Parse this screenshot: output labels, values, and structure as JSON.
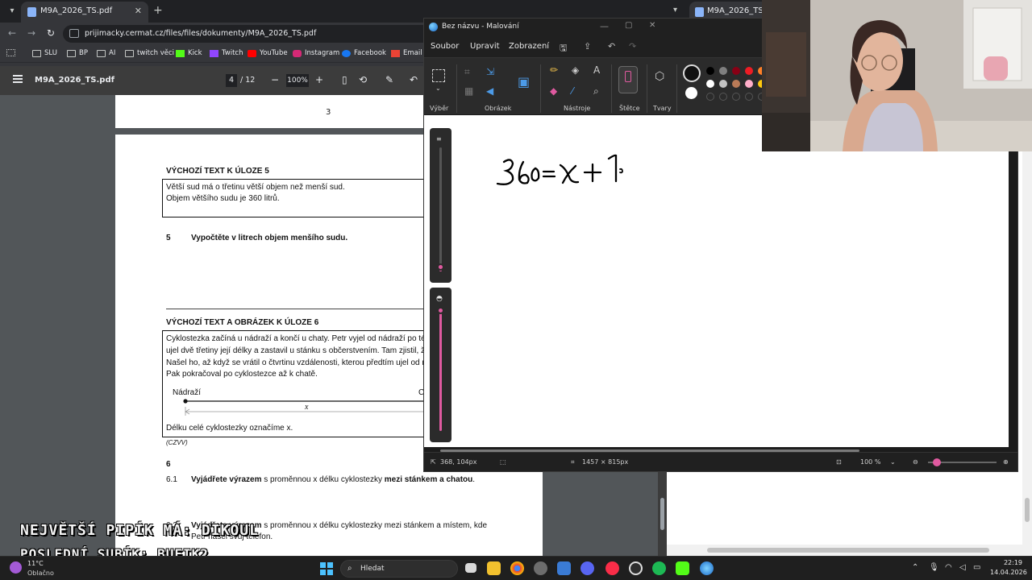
{
  "browser": {
    "tab_title": "M9A_2026_TS.pdf",
    "url": "prijimacky.cermat.cz/files/files/dokumenty/M9A_2026_TS.pdf",
    "bookmarks": [
      "SLU",
      "BP",
      "AI",
      "twitch věci",
      "Kick",
      "Twitch",
      "YouTube",
      "Instagram",
      "Facebook",
      "Email"
    ]
  },
  "pdf": {
    "filename": "M9A_2026_TS.pdf",
    "page_current": "4",
    "page_total": "/ 12",
    "zoom": "100%",
    "prev_page_number": "3",
    "section5_heading": "VÝCHOZÍ TEXT K ÚLOZE 5",
    "section5_line1": "Větší sud má o třetinu větší objem než menší sud.",
    "section5_line2": "Objem většího sudu je 360 litrů.",
    "task5_number": "5",
    "task5_text": "Vypočtěte v litrech objem menšího sudu.",
    "section6_heading": "VÝCHOZÍ TEXT A OBRÁZEK K ÚLOZE 6",
    "section6_line1": "Cyklostezka začíná u nádraží a končí u chaty. Petr vyjel od nádraží po tét",
    "section6_line2": "ujel dvě třetiny její délky a zastavil u stánku s občerstvením. Tam zjistil, ž",
    "section6_line3": "Našel ho, až když se vrátil o čtvrtinu vzdálenosti, kterou předtím ujel od n",
    "section6_line4": "Pak pokračoval po cyklostezce až k chatě.",
    "diagram_left_label": "Nádraží",
    "diagram_right_label": "C",
    "diagram_x_label": "x",
    "section6_caption": "Délku celé cyklostezky označíme x.",
    "source": "(CZVV)",
    "task6_number": "6",
    "task61_number": "6.1",
    "task61_bold": "Vyjádřete výrazem",
    "task61_rest": "s proměnnou x délku cyklostezky",
    "task61_bold2": "mezi stánkem a chatou",
    "task61_end": ".",
    "task62_number": "6.2",
    "task62_bold": "Vyjádřete výrazem",
    "task62_rest": "s proměnnou x délku cyklostezky mezi stánkem a místem, kde",
    "task62_line2": "Petr našel svůj telefon."
  },
  "right_browser": {
    "tab_title": "M9A_2026_TS.pdf"
  },
  "paint": {
    "window_title": "Bez názvu - Malování",
    "menu": [
      "Soubor",
      "Upravit",
      "Zobrazení"
    ],
    "groups": [
      "Výběr",
      "Obrázek",
      "Nástroje",
      "Štětce",
      "Tvary"
    ],
    "palette": [
      "#000000",
      "#7f7f7f",
      "#880015",
      "#ed1c24",
      "#ffffff",
      "#c3c3c3",
      "#b97a57",
      "#ffaec9",
      "#ffc90e"
    ],
    "primary_color": "#111111",
    "status_cursor": "368, 104px",
    "status_size": "1457 × 815px",
    "status_zoom": "100 %",
    "canvas_text": "360 = x + 1"
  },
  "overlay": {
    "line1": "NEJVĚTŠÍ PIPÍK MÁ: DIKOUL",
    "line2": "POSLEDNÍ SUBÍK: BUFIK2"
  },
  "taskbar": {
    "temperature": "11°C",
    "condition": "Oblačno",
    "search_placeholder": "Hledat",
    "time": "22:19",
    "date": "14.04.2026"
  }
}
